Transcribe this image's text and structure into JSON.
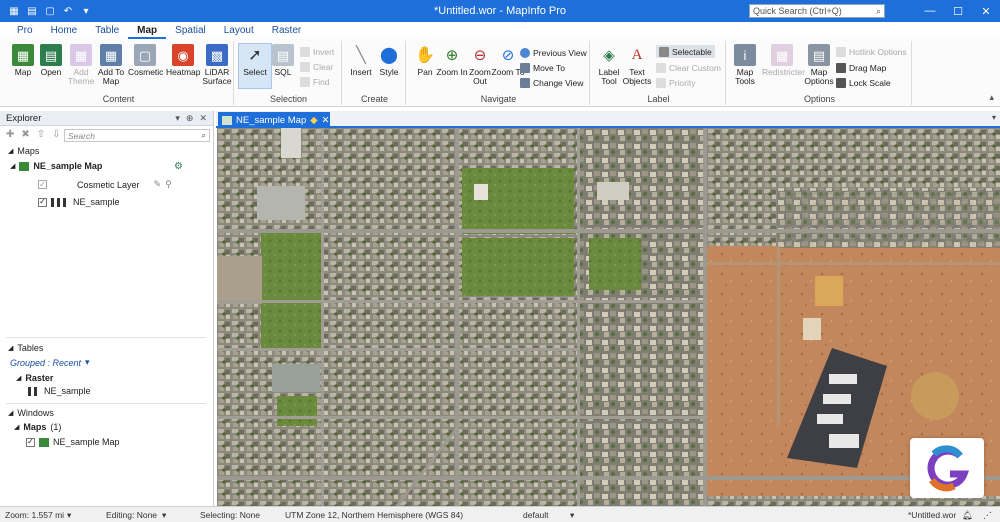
{
  "window": {
    "title": "*Untitled.wor - MapInfo Pro",
    "quick_search_placeholder": "Quick Search (Ctrl+Q)"
  },
  "ribbon_tabs": [
    "Pro",
    "Home",
    "Table",
    "Map",
    "Spatial",
    "Layout",
    "Raster"
  ],
  "ribbon": {
    "content": {
      "label": "Content",
      "map": "Map",
      "open": "Open",
      "add_theme": "Add Theme",
      "add_to_map": "Add To Map",
      "cosmetic": "Cosmetic",
      "heatmap": "Heatmap",
      "lidar_surface": "LiDAR Surface"
    },
    "selection": {
      "label": "Selection",
      "select": "Select",
      "sql": "SQL",
      "invert": "Invert",
      "clear": "Clear",
      "find": "Find"
    },
    "create": {
      "label": "Create",
      "insert": "Insert",
      "style": "Style"
    },
    "navigate": {
      "label": "Navigate",
      "pan": "Pan",
      "zoom_in": "Zoom In",
      "zoom_out": "Zoom Out",
      "zoom_to": "Zoom To",
      "previous_view": "Previous View",
      "move_to": "Move To",
      "change_view": "Change View"
    },
    "label_group": {
      "label": "Label",
      "label_tool": "Label Tool",
      "text_objects": "Text Objects",
      "selectable": "Selectable",
      "clear_custom": "Clear Custom",
      "priority": "Priority"
    },
    "options": {
      "label": "Options",
      "map_tools": "Map Tools",
      "redistricter": "Redistricter",
      "map_options": "Map Options",
      "hotlink_options": "Hotlink Options",
      "drag_map": "Drag Map",
      "lock_scale": "Lock Scale"
    }
  },
  "explorer": {
    "title": "Explorer",
    "search_placeholder": "Search",
    "maps_header": "Maps",
    "map_name": "NE_sample Map",
    "layers": [
      "Cosmetic Layer",
      "NE_sample"
    ],
    "tables_header": "Tables",
    "grouped_label": "Grouped : Recent",
    "raster_header": "Raster",
    "raster_item": "NE_sample",
    "windows_header": "Windows",
    "maps_group": "Maps",
    "maps_count": "(1)",
    "window_item": "NE_sample Map"
  },
  "document_tab": {
    "label": "NE_sample Map"
  },
  "status": {
    "zoom": "Zoom: 1.557 mi",
    "editing": "Editing: None",
    "selecting": "Selecting: None",
    "projection": "UTM Zone 12, Northern Hemisphere (WGS 84)",
    "style": "default",
    "workspace": "*Untitled.wor"
  },
  "colors": {
    "accent": "#1e6fd9",
    "vegetation": "#6b8a3e",
    "desert": "#c2875c"
  }
}
